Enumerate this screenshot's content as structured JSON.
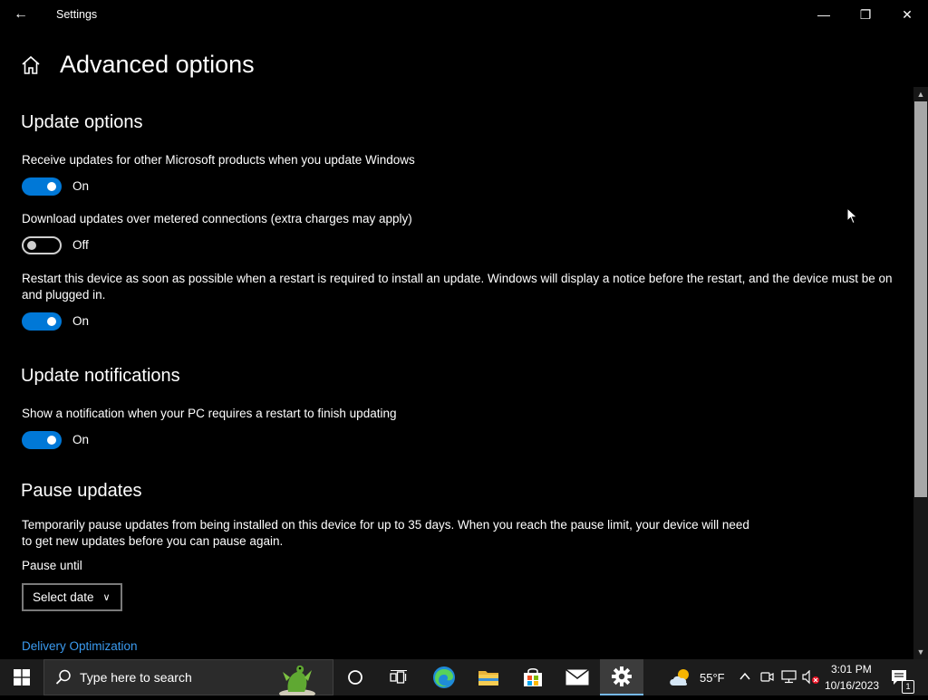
{
  "window": {
    "title": "Settings",
    "back_glyph": "←",
    "minimize_glyph": "—",
    "restore_glyph": "❐",
    "close_glyph": "✕"
  },
  "page": {
    "title": "Advanced options"
  },
  "update_options": {
    "heading": "Update options",
    "items": [
      {
        "label": "Receive updates for other Microsoft products when you update Windows",
        "state": "On",
        "enabled": true
      },
      {
        "label": "Download updates over metered connections (extra charges may apply)",
        "state": "Off",
        "enabled": false
      },
      {
        "label": "Restart this device as soon as possible when a restart is required to install an update. Windows will display a notice before the restart, and the device must be on and plugged in.",
        "state": "On",
        "enabled": true
      }
    ]
  },
  "update_notifications": {
    "heading": "Update notifications",
    "item": {
      "label": "Show a notification when your PC requires a restart to finish updating",
      "state": "On",
      "enabled": true
    }
  },
  "pause_updates": {
    "heading": "Pause updates",
    "description": "Temporarily pause updates from being installed on this device for up to 35 days. When you reach the pause limit, your device will need to get new updates before you can pause again.",
    "pause_until_label": "Pause until",
    "select_value": "Select date",
    "chevron_glyph": "∨"
  },
  "links": {
    "delivery_optimization": "Delivery Optimization"
  },
  "scrollbar": {
    "up_glyph": "▲",
    "down_glyph": "▼"
  },
  "taskbar": {
    "search_placeholder": "Type here to search",
    "weather_temp": "55°F",
    "time": "3:01 PM",
    "date": "10/16/2023",
    "notification_count": "1"
  },
  "colors": {
    "accent": "#0078d7",
    "link": "#3b9bf0",
    "background": "#000000"
  },
  "icons": [
    "home-icon",
    "windows-start-icon",
    "search-icon",
    "cortana-icon",
    "task-view-icon",
    "edge-icon",
    "file-explorer-icon",
    "store-icon",
    "mail-icon",
    "settings-gear-icon",
    "weather-icon",
    "chevron-up-icon",
    "meet-now-icon",
    "network-icon",
    "volume-muted-icon",
    "notification-icon"
  ]
}
